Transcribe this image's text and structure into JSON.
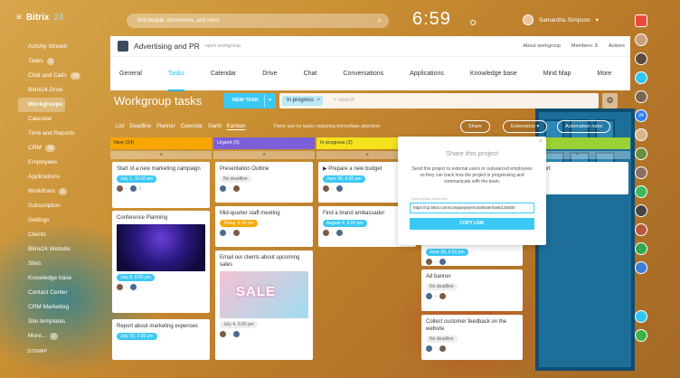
{
  "topbar": {
    "logo": "Bitrix",
    "logo_num": "24",
    "search_placeholder": "find people, documents, and more",
    "clock": "6:59",
    "user_name": "Samantha Simpson",
    "notif_count": "24"
  },
  "sidebar": {
    "items": [
      {
        "label": "Activity Stream",
        "count": ""
      },
      {
        "label": "Tasks",
        "count": "1"
      },
      {
        "label": "Chat and Calls",
        "count": "14"
      },
      {
        "label": "Bitrix24.Drive",
        "count": ""
      },
      {
        "label": "Workgroups",
        "count": ""
      },
      {
        "label": "Calendar",
        "count": ""
      },
      {
        "label": "Time and Reports",
        "count": ""
      },
      {
        "label": "CRM",
        "count": "15"
      },
      {
        "label": "Employees",
        "count": ""
      },
      {
        "label": "Applications",
        "count": ""
      },
      {
        "label": "Workflows",
        "count": "1"
      },
      {
        "label": "Subscription",
        "count": ""
      },
      {
        "label": "Settings",
        "count": ""
      },
      {
        "label": "Clients",
        "count": ""
      },
      {
        "label": "Bitrix24 Website",
        "count": ""
      },
      {
        "label": "Sites",
        "count": ""
      },
      {
        "label": "Knowledge base",
        "count": ""
      },
      {
        "label": "Contact Center",
        "count": ""
      },
      {
        "label": "CRM Marketing",
        "count": ""
      },
      {
        "label": "Site templates",
        "count": ""
      },
      {
        "label": "More...",
        "count": "2"
      }
    ],
    "sitemap": "SITEMAP"
  },
  "group": {
    "title": "Advertising and PR",
    "type": "open workgroup",
    "about": "About workgroup",
    "members": "Members: 8",
    "actions": "Actions"
  },
  "tabs": [
    "General",
    "Tasks",
    "Calendar",
    "Drive",
    "Chat",
    "Conversations",
    "Applications",
    "Knowledge base",
    "Mind Map",
    "More"
  ],
  "toolbar": {
    "title": "Workgroup tasks",
    "new_task": "NEW TASK",
    "filter_chip": "In progress",
    "search_placeholder": "+ search"
  },
  "views": [
    "List",
    "Deadline",
    "Planner",
    "Calendar",
    "Gantt",
    "Kanban"
  ],
  "no_deadline_msg": "There are no tasks requiring immediate attention",
  "buttons": {
    "share": "Share",
    "extensions": "Extensions",
    "automation": "Automation rules"
  },
  "columns": [
    {
      "label": "New",
      "count": "(24)",
      "color": "#f7a700"
    },
    {
      "label": "Urgent",
      "count": "(9)",
      "color": "#7b5fd8"
    },
    {
      "label": "In progress",
      "count": "(2)",
      "color": "#f4e21d"
    },
    {
      "label": "",
      "count": "",
      "color": "#9ad135"
    }
  ],
  "cards": {
    "c1": {
      "title": "Start of a new marketing campaign",
      "date": "July 1, 11:00 am",
      "count": "1"
    },
    "c2": {
      "title": "Conference Planning",
      "date": "July 8, 6:00 pm"
    },
    "c3": {
      "title": "Report about marketing expenses",
      "date": "July 15, 3:00 pm"
    },
    "u1": {
      "title": "Presentation Outline",
      "date": "No deadline"
    },
    "u2": {
      "title": "Mid-quarter staff meeting",
      "date": "Today, 6:00 pm"
    },
    "u3": {
      "title": "Email our clients about upcoming sales",
      "date": "July 4, 6:00 pm",
      "image_text": "SALE"
    },
    "p1": {
      "title": "Prepare a new budget",
      "date": "June 30, 6:00 pm"
    },
    "p2": {
      "title": "Find a brand ambassador",
      "date": "August 4, 6:00 pm"
    },
    "g1": {
      "title": "ly report"
    },
    "g2": {
      "date": "June 30, 6:00 pm"
    },
    "g3": {
      "title": "Ad banner",
      "date": "No deadline"
    },
    "g4": {
      "title": "Collect customer feedback on the website",
      "date": "No deadline"
    }
  },
  "share": {
    "title": "Share this project",
    "desc": "Send this project to external users or outsourced employees so they can track how the project is progressing and communicate with the team.",
    "link_label": "Quick public direct link",
    "link": "https://cp.bitrix.com/company/personal/user/task/125400",
    "copy": "COPY LINK"
  }
}
